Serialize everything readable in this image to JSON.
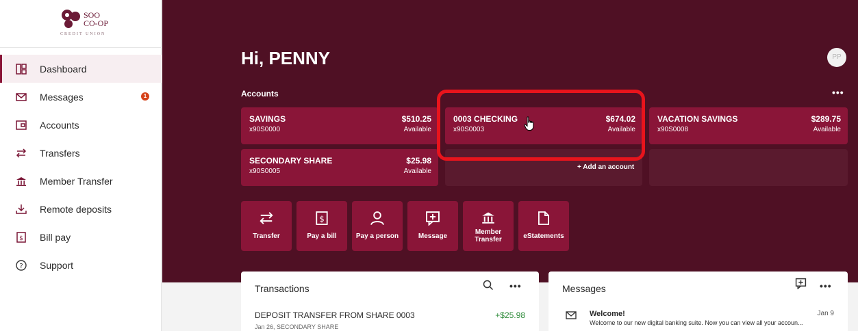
{
  "brand": {
    "name_line1": "SOO",
    "name_line2": "CO-OP",
    "subtitle": "CREDIT UNION",
    "color": "#8a1538"
  },
  "sidebar": {
    "items": [
      {
        "label": "Dashboard",
        "icon": "dashboard-icon",
        "active": true
      },
      {
        "label": "Messages",
        "icon": "envelope-icon",
        "badge": "1"
      },
      {
        "label": "Accounts",
        "icon": "wallet-icon"
      },
      {
        "label": "Transfers",
        "icon": "transfer-arrows-icon"
      },
      {
        "label": "Member Transfer",
        "icon": "bank-icon"
      },
      {
        "label": "Remote deposits",
        "icon": "deposit-icon"
      },
      {
        "label": "Bill pay",
        "icon": "bill-icon"
      },
      {
        "label": "Support",
        "icon": "help-icon"
      }
    ]
  },
  "header": {
    "greeting": "Hi, PENNY",
    "avatar_initials": "PP"
  },
  "accounts": {
    "heading": "Accounts",
    "more": "•••",
    "cards": [
      {
        "name": "SAVINGS",
        "number": "x90S0000",
        "amount": "$510.25",
        "status": "Available"
      },
      {
        "name": "0003 CHECKING",
        "number": "x90S0003",
        "amount": "$674.02",
        "status": "Available"
      },
      {
        "name": "VACATION SAVINGS",
        "number": "x90S0008",
        "amount": "$289.75",
        "status": "Available"
      },
      {
        "name": "SECONDARY SHARE",
        "number": "x90S0005",
        "amount": "$25.98",
        "status": "Available"
      }
    ],
    "add_label": "+ Add an account"
  },
  "quick_actions": [
    {
      "label": "Transfer",
      "icon": "transfer-arrows-icon"
    },
    {
      "label": "Pay a bill",
      "icon": "bill-icon"
    },
    {
      "label": "Pay a person",
      "icon": "person-icon"
    },
    {
      "label": "Message",
      "icon": "message-plus-icon"
    },
    {
      "label": "Member Transfer",
      "icon": "bank-icon"
    },
    {
      "label": "eStatements",
      "icon": "document-icon"
    }
  ],
  "transactions": {
    "title": "Transactions",
    "more": "•••",
    "items": [
      {
        "description": "DEPOSIT TRANSFER FROM SHARE 0003",
        "meta": "Jan 26, SECONDARY SHARE",
        "amount": "+$25.98"
      }
    ]
  },
  "messages": {
    "title": "Messages",
    "more": "•••",
    "items": [
      {
        "subject": "Welcome!",
        "date": "Jan 9",
        "preview": "Welcome to our new digital banking suite. Now you can view all your accoun..."
      }
    ]
  },
  "colors": {
    "hero_bg": "#4f1024",
    "card_bg": "#8a1538",
    "highlight": "#e8141c",
    "badge": "#d6431b",
    "positive": "#2e8b3a"
  }
}
